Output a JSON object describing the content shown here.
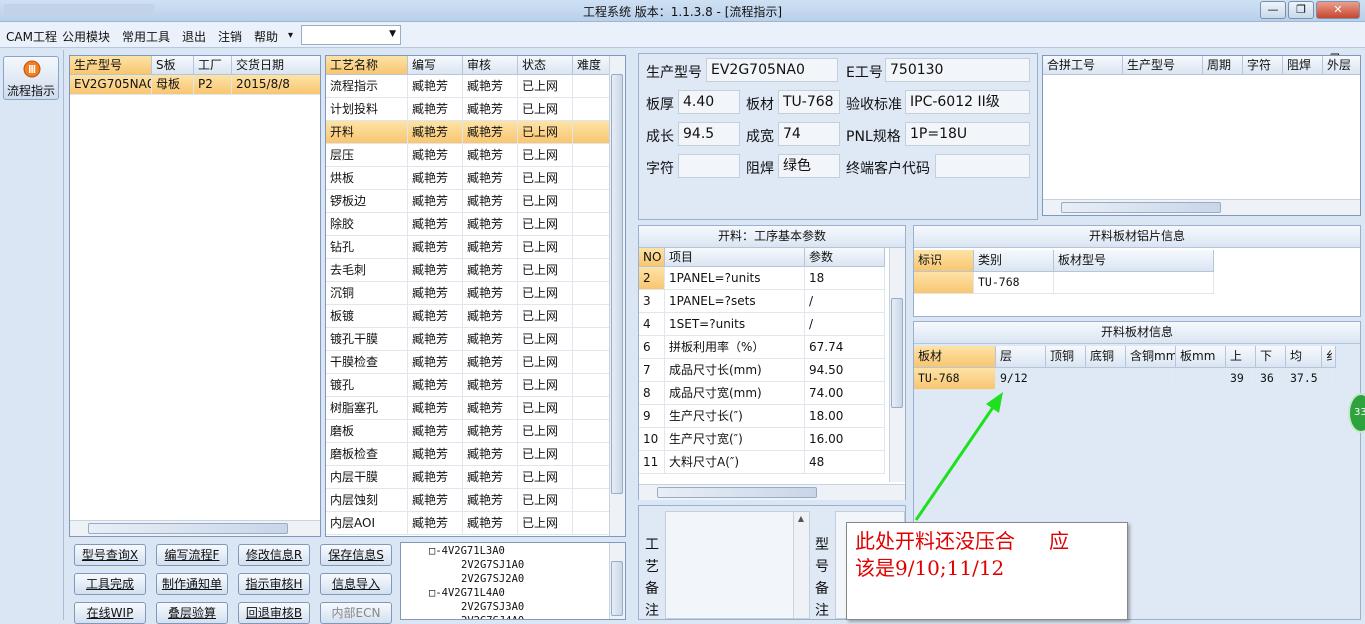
{
  "window": {
    "title": "工程系统  版本：1.1.3.8 - [流程指示]",
    "minimize": "—",
    "restore": "❐",
    "close": "✕"
  },
  "menu": [
    "CAM工程",
    "公用模块",
    "常用工具",
    "退出",
    "注销",
    "帮助"
  ],
  "menu_dropdown_arrow": "▾",
  "mdi_controls": [
    "▁",
    "❐",
    "✕"
  ],
  "nav": {
    "label": "流程指示"
  },
  "orders": {
    "columns": [
      "生产型号",
      "S板",
      "工厂",
      "交货日期"
    ],
    "rows": [
      [
        "EV2G705NA0",
        "母板",
        "P2",
        "2015/8/8"
      ]
    ]
  },
  "process": {
    "columns": [
      "工艺名称",
      "编写",
      "审核",
      "状态",
      "难度"
    ],
    "rows": [
      [
        "流程指示",
        "臧艳芳",
        "臧艳芳",
        "已上网",
        ""
      ],
      [
        "计划投料",
        "臧艳芳",
        "臧艳芳",
        "已上网",
        ""
      ],
      [
        "开料",
        "臧艳芳",
        "臧艳芳",
        "已上网",
        ""
      ],
      [
        "层压",
        "臧艳芳",
        "臧艳芳",
        "已上网",
        ""
      ],
      [
        "烘板",
        "臧艳芳",
        "臧艳芳",
        "已上网",
        ""
      ],
      [
        "锣板边",
        "臧艳芳",
        "臧艳芳",
        "已上网",
        ""
      ],
      [
        "除胶",
        "臧艳芳",
        "臧艳芳",
        "已上网",
        ""
      ],
      [
        "钻孔",
        "臧艳芳",
        "臧艳芳",
        "已上网",
        ""
      ],
      [
        "去毛刺",
        "臧艳芳",
        "臧艳芳",
        "已上网",
        ""
      ],
      [
        "沉铜",
        "臧艳芳",
        "臧艳芳",
        "已上网",
        ""
      ],
      [
        "板镀",
        "臧艳芳",
        "臧艳芳",
        "已上网",
        ""
      ],
      [
        "镀孔干膜",
        "臧艳芳",
        "臧艳芳",
        "已上网",
        ""
      ],
      [
        "干膜检查",
        "臧艳芳",
        "臧艳芳",
        "已上网",
        ""
      ],
      [
        "镀孔",
        "臧艳芳",
        "臧艳芳",
        "已上网",
        ""
      ],
      [
        "树脂塞孔",
        "臧艳芳",
        "臧艳芳",
        "已上网",
        ""
      ],
      [
        "磨板",
        "臧艳芳",
        "臧艳芳",
        "已上网",
        ""
      ],
      [
        "磨板检查",
        "臧艳芳",
        "臧艳芳",
        "已上网",
        ""
      ],
      [
        "内层干膜",
        "臧艳芳",
        "臧艳芳",
        "已上网",
        ""
      ],
      [
        "内层蚀刻",
        "臧艳芳",
        "臧艳芳",
        "已上网",
        ""
      ],
      [
        "内层AOI",
        "臧艳芳",
        "臧艳芳",
        "已上网",
        ""
      ]
    ],
    "selected_index": 2
  },
  "info": {
    "model_label": "生产型号",
    "model_value": "EV2G705NA0",
    "eno_label": "E工号",
    "eno_value": "750130",
    "thick_label": "板厚",
    "thick_value": "4.40",
    "material_label": "板材",
    "material_value": "TU-768",
    "standard_label": "验收标准",
    "standard_value": "IPC-6012 II级",
    "length_label": "成长",
    "length_value": "94.5",
    "width_label": "成宽",
    "width_value": "74",
    "pnl_label": "PNL规格",
    "pnl_value": "1P=18U",
    "char_label": "字符",
    "char_value": "",
    "mask_label": "阻焊",
    "mask_value": "绿色",
    "customer_label": "终端客户代码",
    "customer_value": ""
  },
  "combine": {
    "columns": [
      "合拼工号",
      "生产型号",
      "周期",
      "字符",
      "阻焊",
      "外层"
    ]
  },
  "params": {
    "title": "开料：工序基本参数",
    "columns": [
      "NO",
      "项目",
      "参数"
    ],
    "rows": [
      [
        "2",
        "1PANEL=?units",
        "18"
      ],
      [
        "3",
        "1PANEL=?sets",
        "/"
      ],
      [
        "4",
        "1SET=?units",
        "/"
      ],
      [
        "6",
        "拼板利用率（%）",
        "67.74"
      ],
      [
        "7",
        "成品尺寸长(mm)",
        "94.50"
      ],
      [
        "8",
        "成品尺寸宽(mm)",
        "74.00"
      ],
      [
        "9",
        "生产尺寸长(″)",
        "18.00"
      ],
      [
        "10",
        "生产尺寸宽(″)",
        "16.00"
      ],
      [
        "11",
        "大料尺寸A(″)",
        "48"
      ]
    ]
  },
  "foil": {
    "title": "开料板材铝片信息",
    "columns": [
      "标识",
      "类别",
      "板材型号"
    ],
    "rows": [
      [
        "",
        "TU-768",
        ""
      ]
    ]
  },
  "board": {
    "title": "开料板材信息",
    "columns": [
      "板材",
      "层",
      "顶铜",
      "底铜",
      "含铜mm",
      "板mm",
      "上",
      "下",
      "均",
      "纟"
    ],
    "rows": [
      [
        "TU-768",
        "9/12",
        "",
        "",
        "",
        "",
        "39",
        "36",
        "37.5",
        ""
      ]
    ]
  },
  "buttons": [
    [
      "型号查询X",
      "编写流程F",
      "修改信息R",
      "保存信息S"
    ],
    [
      "工具完成",
      "制作通知单",
      "指示审核H",
      "信息导入"
    ],
    [
      "在线WIP",
      "叠层验算",
      "回退审核B",
      "内部ECN"
    ]
  ],
  "tree": [
    [
      "□-4V2G71L3A0",
      0
    ],
    [
      "2V2G7SJ1A0",
      1
    ],
    [
      "2V2G7SJ2A0",
      1
    ],
    [
      "□-4V2G71L4A0",
      0
    ],
    [
      "2V2G7SJ3A0",
      1
    ],
    [
      "2V2G7SJ4A0",
      1
    ]
  ],
  "memo": {
    "craft_label": [
      "工",
      "艺",
      "备",
      "注"
    ],
    "model_label": [
      "型",
      "号",
      "备",
      "注"
    ]
  },
  "annotation": {
    "line1": "此处开料还没压合",
    "line1b": "应",
    "line2": "该是9/10;11/12"
  },
  "badge": "33"
}
